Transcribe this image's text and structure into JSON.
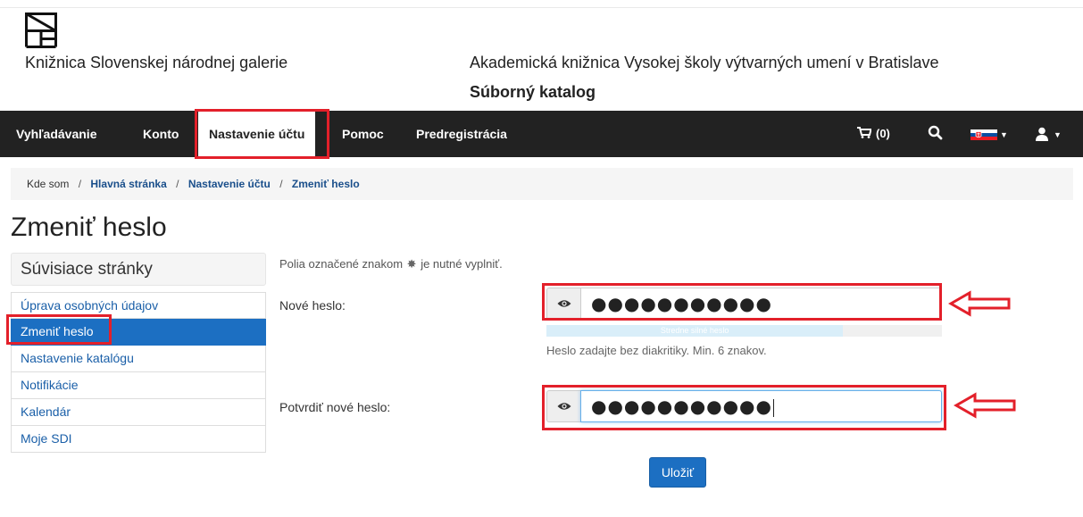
{
  "header": {
    "library_left": "Knižnica Slovenskej národnej galerie",
    "library_right": "Akademická knižnica Vysokej školy výtvarných umení v Bratislave",
    "catalog_title": "Súborný katalog"
  },
  "nav": {
    "items": [
      "Vyhľadávanie",
      "Konto",
      "Nastavenie účtu",
      "Pomoc",
      "Predregistrácia"
    ],
    "active_item": "Nastavenie účtu",
    "cart_label": "(0)",
    "language_flag": "sk-flag-icon"
  },
  "breadcrumb": {
    "label": "Kde som",
    "separator": "/",
    "links": [
      "Hlavná stránka",
      "Nastavenie účtu",
      "Zmeniť heslo"
    ]
  },
  "page": {
    "title": "Zmeniť heslo"
  },
  "sidebar": {
    "heading": "Súvisiace stránky",
    "items": [
      "Úprava osobných údajov",
      "Zmeniť heslo",
      "Nastavenie katalógu",
      "Notifikácie",
      "Kalendár",
      "Moje SDI"
    ],
    "active_item": "Zmeniť heslo"
  },
  "form": {
    "required_note_before": "Polia označené znakom",
    "required_note_after": "je nutné vyplniť.",
    "new_password_label": "Nové heslo:",
    "new_password_value": "●●●●●●●●●●●",
    "strength_text": "Stredne silné heslo",
    "strength_level": 0.75,
    "hint": "Heslo zadajte bez diakritiky. Min. 6 znakov.",
    "confirm_password_label": "Potvrdiť nové heslo:",
    "confirm_password_value": "●●●●●●●●●●●",
    "save_label": "Uložiť"
  },
  "colors": {
    "navbar": "#222222",
    "accent": "#1c6fc2",
    "highlight": "#e3202a",
    "link": "#1a4f8b"
  }
}
